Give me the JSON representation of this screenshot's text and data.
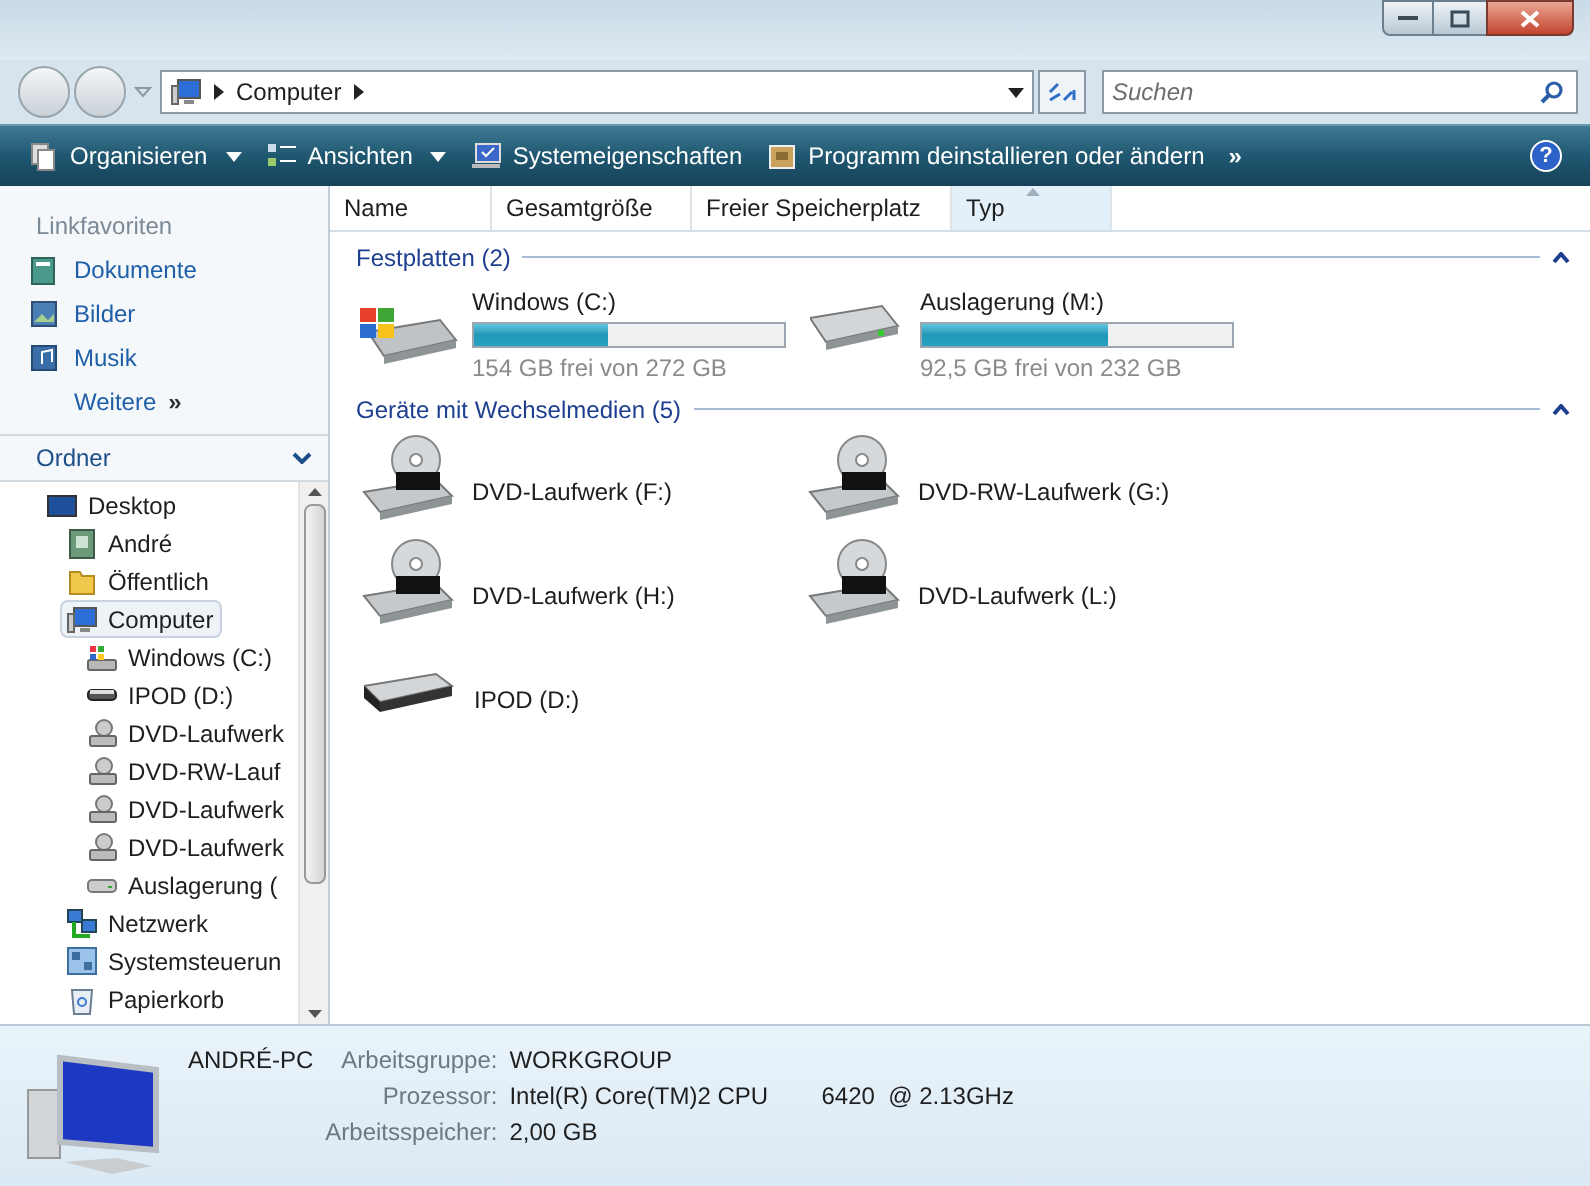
{
  "address_bar": {
    "path": [
      "Computer"
    ]
  },
  "search": {
    "placeholder": "Suchen"
  },
  "toolbar": {
    "items": [
      {
        "label": "Organisieren",
        "kind": "organize",
        "dropdown": true
      },
      {
        "label": "Ansichten",
        "kind": "views",
        "dropdown": true
      },
      {
        "label": "Systemeigenschaften",
        "kind": "system",
        "dropdown": false
      },
      {
        "label": "Programm deinstallieren oder ändern",
        "kind": "programs",
        "dropdown": false
      }
    ],
    "more": "»",
    "help": "?"
  },
  "sidebar": {
    "favorites_title": "Linkfavoriten",
    "favorites": [
      {
        "label": "Dokumente",
        "kind": "documents"
      },
      {
        "label": "Bilder",
        "kind": "pictures"
      },
      {
        "label": "Musik",
        "kind": "music"
      }
    ],
    "more": {
      "label": "Weitere",
      "chevron": "»"
    },
    "folders_title": "Ordner",
    "tree": [
      {
        "label": "Desktop",
        "kind": "desktop",
        "selected": false,
        "children": [
          {
            "label": "André",
            "kind": "user",
            "selected": false
          },
          {
            "label": "Öffentlich",
            "kind": "folder",
            "selected": false
          },
          {
            "label": "Computer",
            "kind": "computer",
            "selected": true,
            "children": [
              {
                "label": "Windows (C:)",
                "kind": "os-drive",
                "selected": false
              },
              {
                "label": "IPOD (D:)",
                "kind": "removable",
                "selected": false
              },
              {
                "label": "DVD-Laufwerk",
                "kind": "dvd",
                "selected": false
              },
              {
                "label": "DVD-RW-Lauf",
                "kind": "dvd",
                "selected": false
              },
              {
                "label": "DVD-Laufwerk",
                "kind": "dvd",
                "selected": false
              },
              {
                "label": "DVD-Laufwerk",
                "kind": "dvd",
                "selected": false
              },
              {
                "label": "Auslagerung (",
                "kind": "hdd",
                "selected": false
              }
            ]
          },
          {
            "label": "Netzwerk",
            "kind": "network",
            "selected": false
          },
          {
            "label": "Systemsteuerun",
            "kind": "control-panel",
            "selected": false
          },
          {
            "label": "Papierkorb",
            "kind": "recycle",
            "selected": false
          }
        ]
      }
    ]
  },
  "columns": [
    {
      "label": "Name",
      "selected": false
    },
    {
      "label": "Gesamtgröße",
      "selected": false
    },
    {
      "label": "Freier Speicherplatz",
      "selected": false
    },
    {
      "label": "Typ",
      "selected": true
    }
  ],
  "groups": [
    {
      "title": "Festplatten (2)",
      "items": [
        {
          "name": "Windows (C:)",
          "kind": "os-drive",
          "level": 0.43,
          "free": "154 GB frei von 272 GB"
        },
        {
          "name": "Auslagerung (M:)",
          "kind": "hdd",
          "level": 0.6,
          "free": "92,5 GB frei von 232 GB"
        }
      ]
    },
    {
      "title": "Geräte mit Wechselmedien (5)",
      "items": [
        {
          "name": "DVD-Laufwerk (F:)",
          "kind": "dvd"
        },
        {
          "name": "DVD-RW-Laufwerk (G:)",
          "kind": "dvd"
        },
        {
          "name": "DVD-Laufwerk (H:)",
          "kind": "dvd"
        },
        {
          "name": "DVD-Laufwerk (L:)",
          "kind": "dvd"
        },
        {
          "name": "IPOD (D:)",
          "kind": "removable"
        }
      ]
    }
  ],
  "details": {
    "computer_name": "ANDRÉ-PC",
    "fields": [
      {
        "label": "Arbeitsgruppe:",
        "value": "WORKGROUP"
      },
      {
        "label": "Prozessor:",
        "value": "Intel(R) Core(TM)2 CPU        6420  @ 2.13GHz"
      },
      {
        "label": "Arbeitsspeicher:",
        "value": "2,00 GB"
      }
    ]
  }
}
